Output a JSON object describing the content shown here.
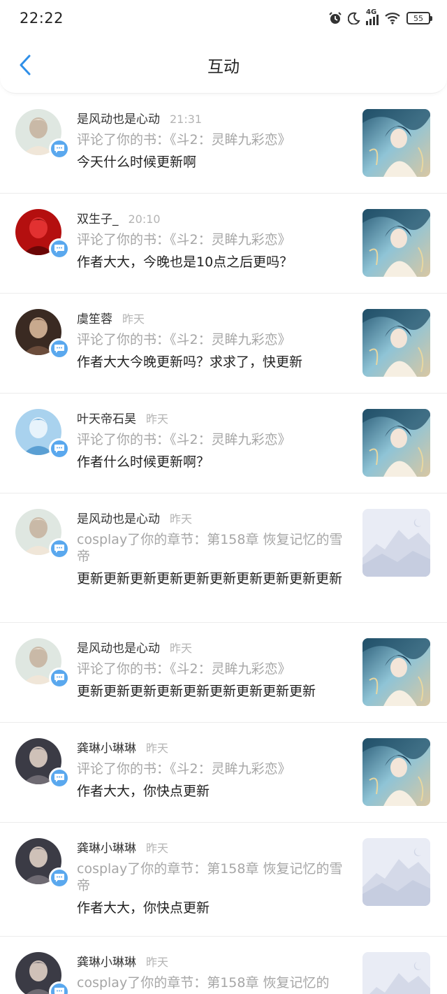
{
  "status": {
    "time": "22:22",
    "network": "4G",
    "battery": "55"
  },
  "header": {
    "title": "互动"
  },
  "items": [
    {
      "name": "是风动也是心动",
      "time": "21:31",
      "action": "评论了你的书：《斗2：灵眸九彩恋》",
      "comment": "今天什么时候更新啊",
      "thumb": "cover"
    },
    {
      "name": "双生子_",
      "time": "20:10",
      "action": "评论了你的书：《斗2：灵眸九彩恋》",
      "comment": "作者大大，今晚也是10点之后更吗？",
      "thumb": "cover"
    },
    {
      "name": "虞笙蓉",
      "time": "昨天",
      "action": "评论了你的书：《斗2：灵眸九彩恋》",
      "comment": "作者大大今晚更新吗？求求了，快更新",
      "thumb": "cover"
    },
    {
      "name": "叶天帝石昊",
      "time": "昨天",
      "action": "评论了你的书：《斗2：灵眸九彩恋》",
      "comment": "作者什么时候更新啊？",
      "thumb": "cover"
    },
    {
      "name": "是风动也是心动",
      "time": "昨天",
      "action": "cosplay了你的章节：第158章 恢复记忆的雪帝",
      "comment": "更新更新更新更新更新更新更新更新更新更新",
      "thumb": "placeholder"
    },
    {
      "name": "是风动也是心动",
      "time": "昨天",
      "action": "评论了你的书：《斗2：灵眸九彩恋》",
      "comment": "更新更新更新更新更新更新更新更新更新",
      "thumb": "cover"
    },
    {
      "name": "龚琳小琳琳",
      "time": "昨天",
      "action": "评论了你的书：《斗2：灵眸九彩恋》",
      "comment": "作者大大，你快点更新",
      "thumb": "cover"
    },
    {
      "name": "龚琳小琳琳",
      "time": "昨天",
      "action": "cosplay了你的章节：第158章 恢复记忆的雪帝",
      "comment": "作者大大，你快点更新",
      "thumb": "placeholder"
    },
    {
      "name": "龚琳小琳琳",
      "time": "昨天",
      "action": "cosplay了你的章节：第158章 恢复记忆的",
      "comment": "",
      "thumb": "placeholder"
    }
  ],
  "icons": {
    "back": "chevron-left-icon",
    "badge": "chat-bubble-icon",
    "alarm": "alarm-icon",
    "moon": "moon-icon",
    "signal": "signal-icon",
    "wifi": "wifi-icon",
    "battery": "battery-icon"
  },
  "colors": {
    "accent": "#2f8fe8",
    "badge": "#5aa8ee",
    "muted": "#a6a6a6"
  }
}
